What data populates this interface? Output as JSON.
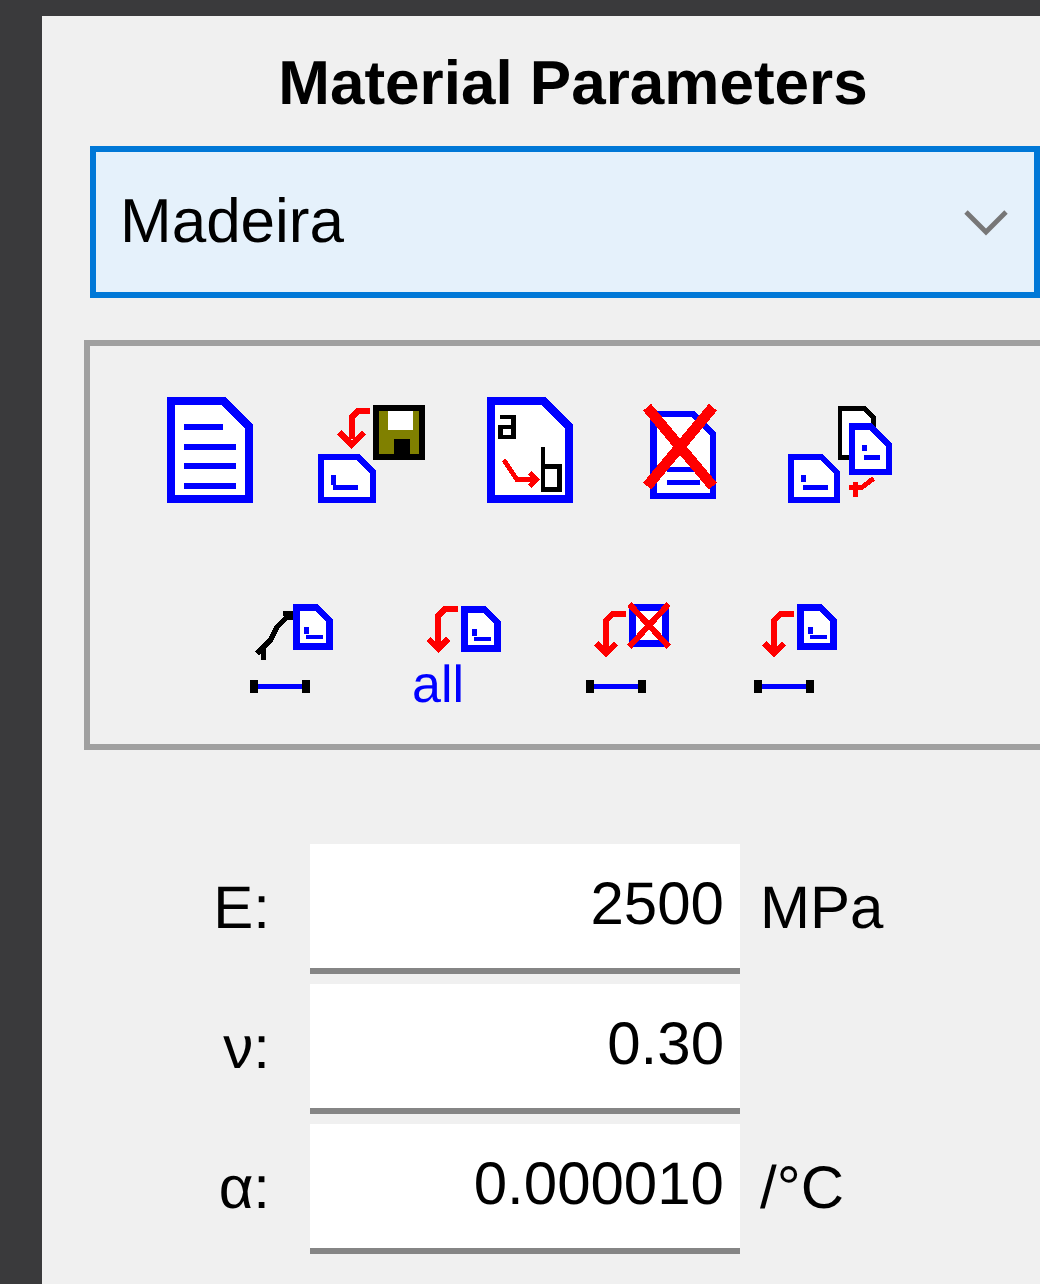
{
  "title": "Material Parameters",
  "material_select": {
    "value": "Madeira"
  },
  "toolbar": {
    "rows": [
      [
        {
          "kind": "new"
        },
        {
          "kind": "save"
        },
        {
          "kind": "rename"
        },
        {
          "kind": "delete"
        },
        {
          "kind": "import"
        }
      ],
      [
        {
          "kind": "link-width"
        },
        {
          "kind": "assign-all",
          "label": "all"
        },
        {
          "kind": "assign-delete"
        },
        {
          "kind": "assign-width"
        }
      ]
    ]
  },
  "fields": [
    {
      "symbol": "E:",
      "value": "2500",
      "unit": "MPa"
    },
    {
      "symbol": "ν:",
      "value": "0.30"
    },
    {
      "symbol": "α:",
      "value": "0.000010",
      "unit": "/°C"
    }
  ]
}
